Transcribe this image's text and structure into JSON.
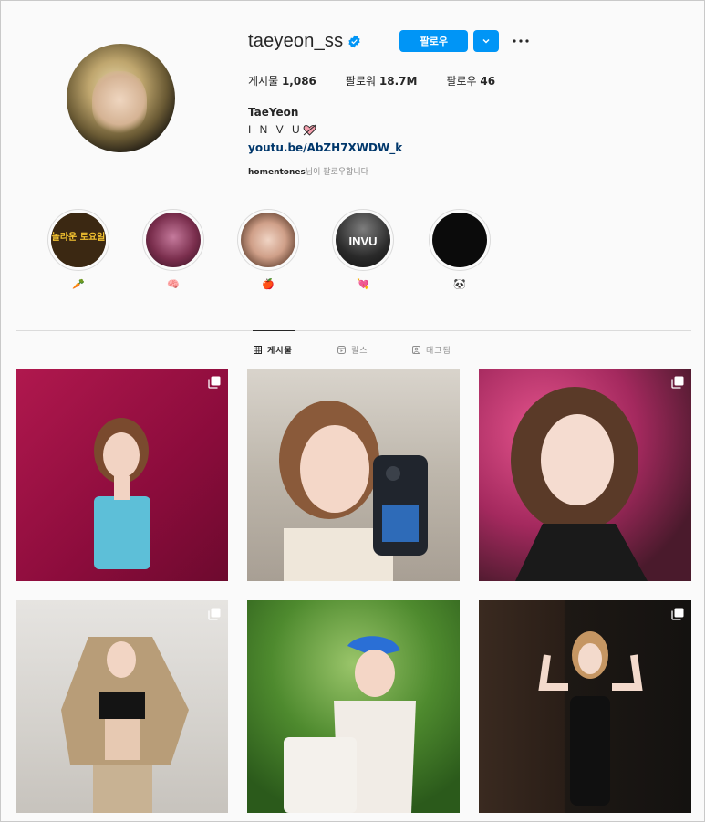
{
  "profile": {
    "username": "taeyeon_ss",
    "follow_label": "팔로우",
    "stats": [
      {
        "label": "게시물",
        "value": "1,086"
      },
      {
        "label": "팔로워",
        "value": "18.7M"
      },
      {
        "label": "팔로우",
        "value": "46"
      }
    ],
    "name": "TaeYeon",
    "tagline": "I N V U",
    "link": "youtu.be/AbZH7XWDW_k",
    "followed_by_user": "homentones",
    "followed_by_suffix": "님이 팔로우합니다"
  },
  "highlights": [
    {
      "label": "🥕",
      "icon": "carrot-icon"
    },
    {
      "label": "🧠",
      "icon": "brain-icon"
    },
    {
      "label": "🍎",
      "icon": "apple-icon"
    },
    {
      "label": "💘",
      "icon": "heart-arrow-icon"
    },
    {
      "label": "🐼",
      "icon": "panda-icon"
    }
  ],
  "highlight_texts": {
    "one": "놀라운 토요일",
    "four": "INVU"
  },
  "tabs": [
    {
      "label": "게시물",
      "icon": "grid-icon",
      "active": true
    },
    {
      "label": "릴스",
      "icon": "reels-icon",
      "active": false
    },
    {
      "label": "태그됨",
      "icon": "tagged-icon",
      "active": false
    }
  ],
  "colors": {
    "accent": "#0095f6",
    "link": "#00376b",
    "divider": "#dbdbdb"
  }
}
